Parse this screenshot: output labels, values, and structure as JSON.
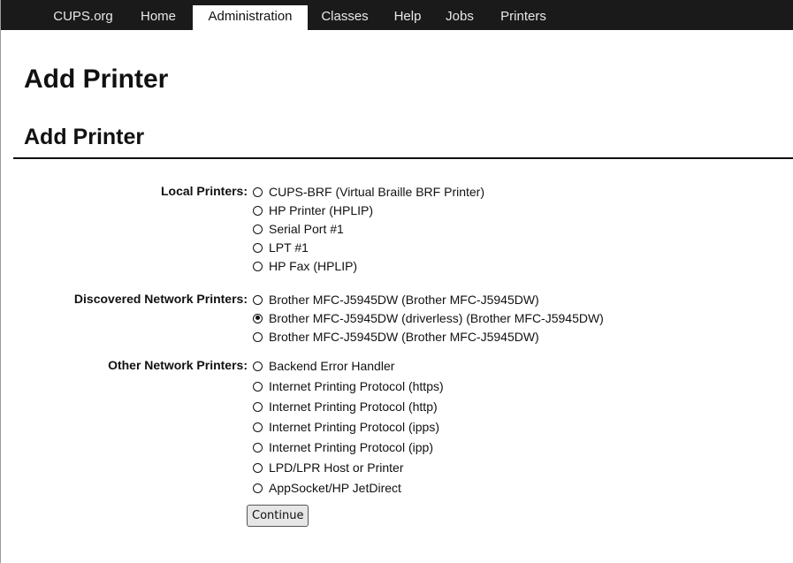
{
  "nav": {
    "tabs": [
      {
        "label": "CUPS.org",
        "active": false
      },
      {
        "label": "Home",
        "active": false
      },
      {
        "label": "Administration",
        "active": true
      },
      {
        "label": "Classes",
        "active": false
      },
      {
        "label": "Help",
        "active": false
      },
      {
        "label": "Jobs",
        "active": false
      },
      {
        "label": "Printers",
        "active": false
      }
    ]
  },
  "page": {
    "title": "Add Printer",
    "section_title": "Add Printer"
  },
  "form": {
    "local_label": "Local Printers:",
    "local": [
      {
        "label": "CUPS-BRF (Virtual Braille BRF Printer)",
        "checked": false
      },
      {
        "label": "HP Printer (HPLIP)",
        "checked": false
      },
      {
        "label": "Serial Port #1",
        "checked": false
      },
      {
        "label": "LPT #1",
        "checked": false
      },
      {
        "label": "HP Fax (HPLIP)",
        "checked": false
      }
    ],
    "discovered_label": "Discovered Network Printers:",
    "discovered": [
      {
        "label": "Brother MFC-J5945DW (Brother MFC-J5945DW)",
        "checked": false
      },
      {
        "label": "Brother MFC-J5945DW (driverless) (Brother MFC-J5945DW)",
        "checked": true
      },
      {
        "label": "Brother MFC-J5945DW (Brother MFC-J5945DW)",
        "checked": false
      }
    ],
    "other_label": "Other Network Printers:",
    "other": [
      {
        "label": "Backend Error Handler",
        "checked": false
      },
      {
        "label": "Internet Printing Protocol (https)",
        "checked": false
      },
      {
        "label": "Internet Printing Protocol (http)",
        "checked": false
      },
      {
        "label": "Internet Printing Protocol (ipps)",
        "checked": false
      },
      {
        "label": "Internet Printing Protocol (ipp)",
        "checked": false
      },
      {
        "label": "LPD/LPR Host or Printer",
        "checked": false
      },
      {
        "label": "AppSocket/HP JetDirect",
        "checked": false
      }
    ],
    "continue_label": "Continue"
  }
}
